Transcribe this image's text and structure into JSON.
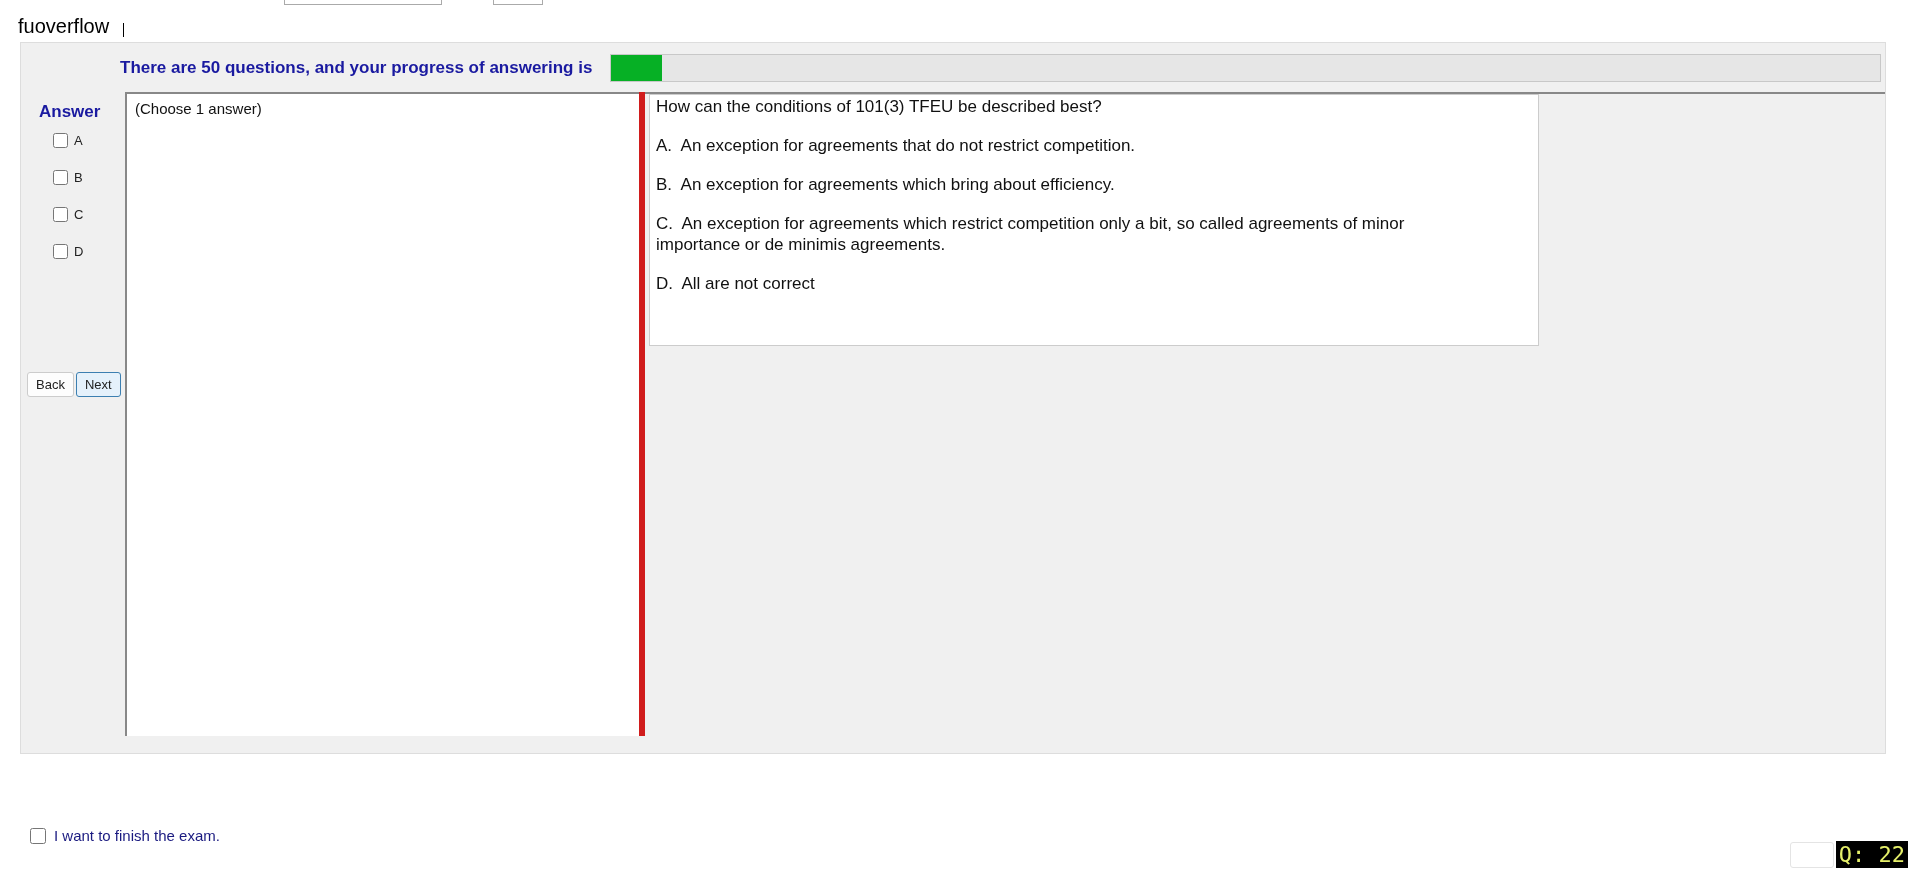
{
  "site_title": "fuoverflow",
  "progress": {
    "label": "There are 50 questions, and your progress of answering is",
    "level": 0.04
  },
  "answer_panel": {
    "title": "Answer",
    "options": [
      {
        "label": "A",
        "checked": false
      },
      {
        "label": "B",
        "checked": false
      },
      {
        "label": "C",
        "checked": false
      },
      {
        "label": "D",
        "checked": false
      }
    ],
    "buttons": [
      {
        "label": "Back",
        "selected": false
      },
      {
        "label": "Next",
        "selected": true
      }
    ]
  },
  "answer_box": {
    "value": "(Choose 1 answer)"
  },
  "question": {
    "text": "How can the conditions of 101(3) TFEU be described best?",
    "choices": [
      "A.  An exception for agreements that do not restrict competition.",
      "B.  An exception for agreements which bring about efficiency.",
      "C.  An exception for agreements which restrict competition only a bit, so called agreements of minor importance or de minimis agreements.",
      "D.  All are not correct"
    ]
  },
  "finish": {
    "label": "I want to finish the exam.",
    "checked": false
  },
  "question_badge": "Q: 22"
}
